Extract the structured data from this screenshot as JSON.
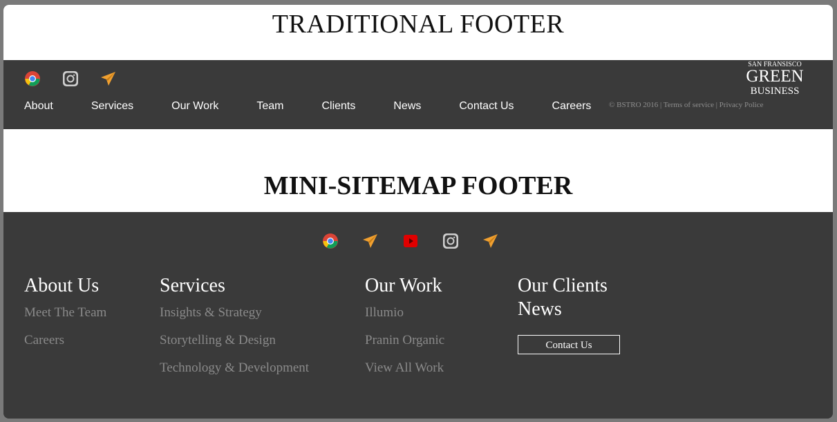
{
  "traditional": {
    "title": "TRADITIONAL FOOTER",
    "icons": [
      "chrome-icon",
      "instagram-icon",
      "telegram-icon"
    ],
    "nav": [
      "About",
      "Services",
      "Our Work",
      "Team",
      "Clients",
      "News",
      "Contact Us",
      "Careers"
    ],
    "legal": "© BSTRO 2016 | Terms of service | Privacy Police",
    "badge": {
      "top": "SAN FRANSISCO",
      "middle": "GREEN",
      "bottom": "BUSINESS"
    }
  },
  "mini": {
    "title": "MINI-SITEMAP FOOTER",
    "icons": [
      "chrome-icon",
      "telegram-icon",
      "youtube-icon",
      "instagram-icon",
      "telegram-icon"
    ],
    "columns": [
      {
        "heading": "About Us",
        "links": [
          "Meet The Team",
          "Careers"
        ]
      },
      {
        "heading": "Services",
        "links": [
          "Insights & Strategy",
          "Storytelling & Design",
          "Technology & Development"
        ]
      },
      {
        "heading": "Our Work",
        "links": [
          "Illumio",
          "Pranin Organic",
          "View All Work"
        ]
      },
      {
        "heading": "Our Clients",
        "heading2": "News",
        "button": "Contact Us"
      }
    ]
  },
  "colors": {
    "footer_bg": "#3a3a3a",
    "accent_orange": "#f0a030",
    "link_gray": "#8a8a8a",
    "youtube_red": "#e00000"
  }
}
